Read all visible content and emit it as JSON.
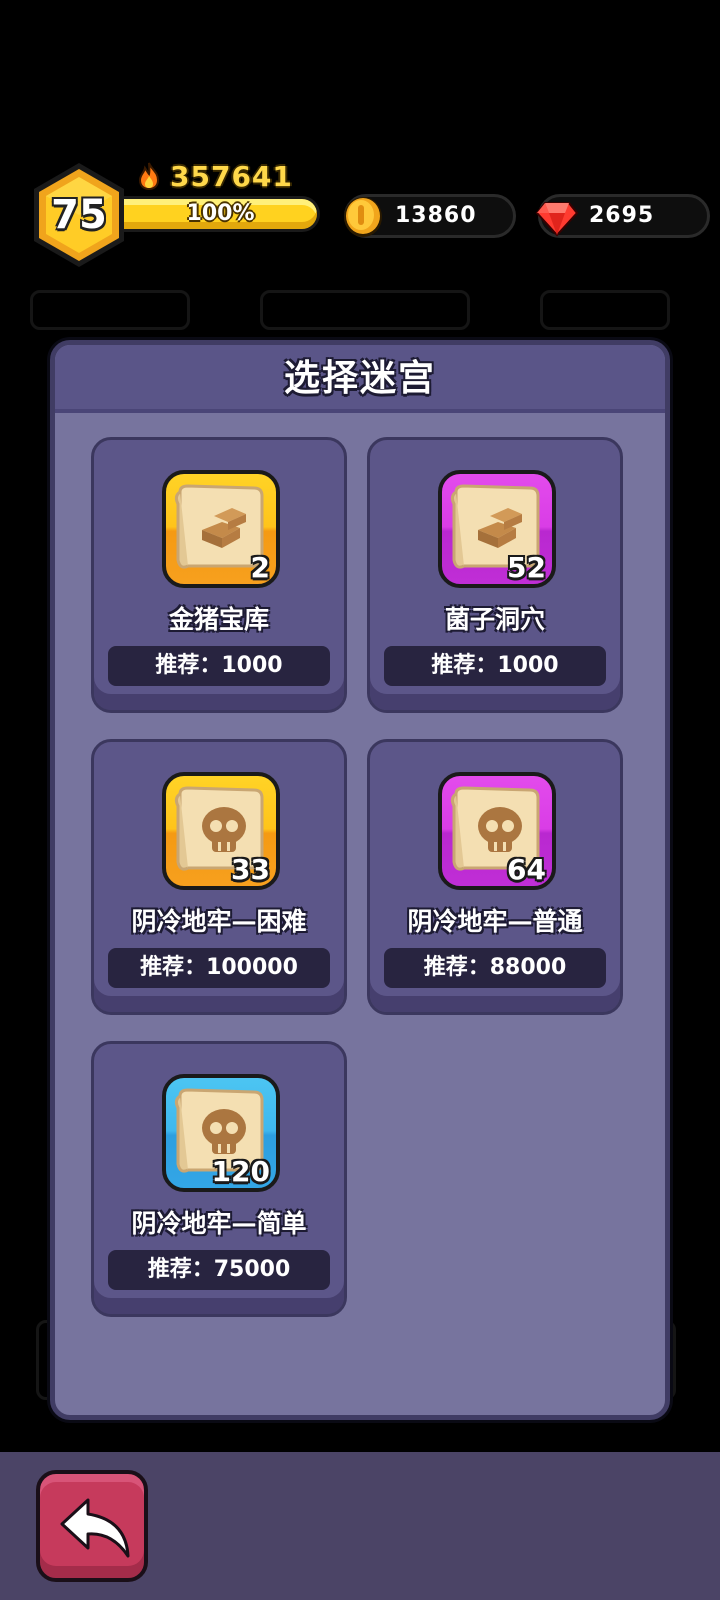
{
  "hud": {
    "level": "75",
    "power": "357641",
    "xp_text": "100%",
    "xp_fraction": 1.0,
    "coins": "13860",
    "gems": "2695"
  },
  "dialog": {
    "title": "选择迷宫",
    "cards": [
      {
        "name": "金猪宝库",
        "count": "2",
        "recommend": "推荐：1000",
        "frame": "gold",
        "icon": "gold-bars-map-icon"
      },
      {
        "name": "菌子洞穴",
        "count": "52",
        "recommend": "推荐：1000",
        "frame": "purple",
        "icon": "gold-bars-map-icon"
      },
      {
        "name": "阴冷地牢—困难",
        "count": "33",
        "recommend": "推荐：100000",
        "frame": "gold",
        "icon": "skull-map-icon"
      },
      {
        "name": "阴冷地牢—普通",
        "count": "64",
        "recommend": "推荐：88000",
        "frame": "purple",
        "icon": "skull-map-icon"
      },
      {
        "name": "阴冷地牢—简单",
        "count": "120",
        "recommend": "推荐：75000",
        "frame": "blue",
        "icon": "skull-map-icon"
      }
    ]
  },
  "colors": {
    "gold_frame": "#ffc41a",
    "purple_frame": "#d93de6",
    "blue_frame": "#3fb8ee",
    "power_text": "#ffd84a",
    "back_button": "#c63a5c"
  }
}
